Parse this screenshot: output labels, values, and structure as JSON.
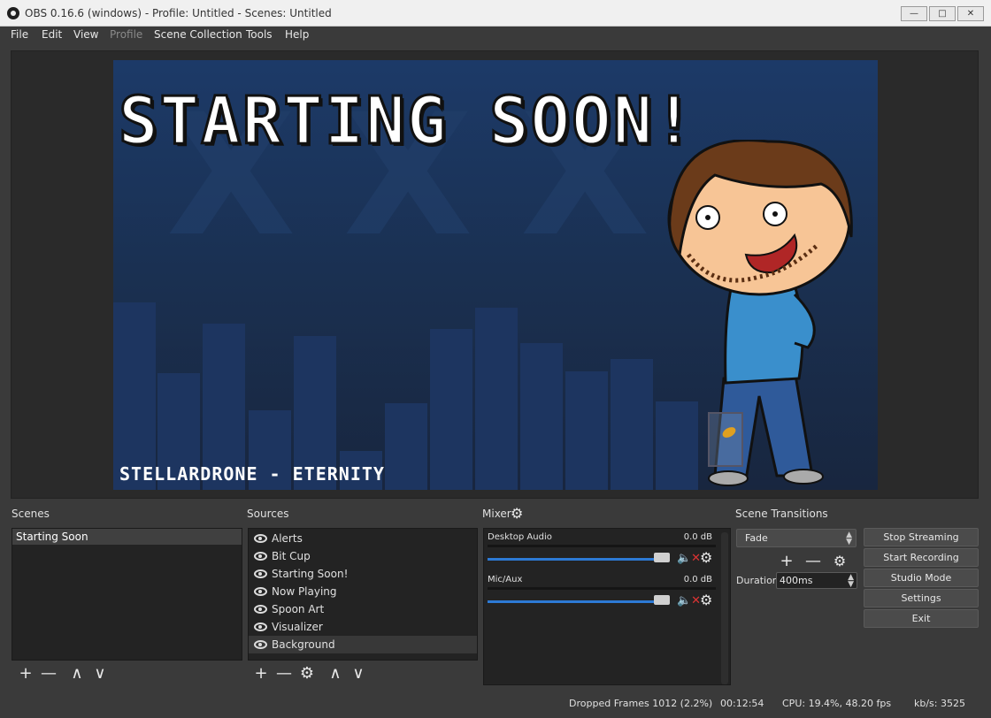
{
  "window": {
    "title": "OBS 0.16.6 (windows) - Profile: Untitled - Scenes: Untitled"
  },
  "menu": [
    "File",
    "Edit",
    "View",
    "Profile",
    "Scene Collection",
    "Tools",
    "Help"
  ],
  "preview": {
    "headline": "STARTING SOON!",
    "footer": "STELLARDRONE - ETERNITY"
  },
  "scenes": {
    "title": "Scenes",
    "items": [
      "Starting Soon"
    ]
  },
  "sources": {
    "title": "Sources",
    "items": [
      "Alerts",
      "Bit Cup",
      "Starting Soon!",
      "Now Playing",
      "Spoon Art",
      "Visualizer",
      "Background"
    ]
  },
  "mixer": {
    "title": "Mixer",
    "channels": [
      {
        "name": "Desktop Audio",
        "db": "0.0 dB",
        "volume": 1.0,
        "muted": true
      },
      {
        "name": "Mic/Aux",
        "db": "0.0 dB",
        "volume": 1.0,
        "muted": true
      }
    ]
  },
  "transitions": {
    "title": "Scene Transitions",
    "selected": "Fade",
    "duration_label": "Duration",
    "duration_value": "400ms"
  },
  "controls": [
    "Stop Streaming",
    "Start Recording",
    "Studio Mode",
    "Settings",
    "Exit"
  ],
  "status": {
    "dropped": "Dropped Frames 1012 (2.2%)",
    "time": "00:12:54",
    "cpu": "CPU: 19.4%, 48.20 fps",
    "kbps": "kb/s: 3525"
  },
  "colors": {
    "accent": "#2d7ad5",
    "mute": "#dd3333"
  }
}
